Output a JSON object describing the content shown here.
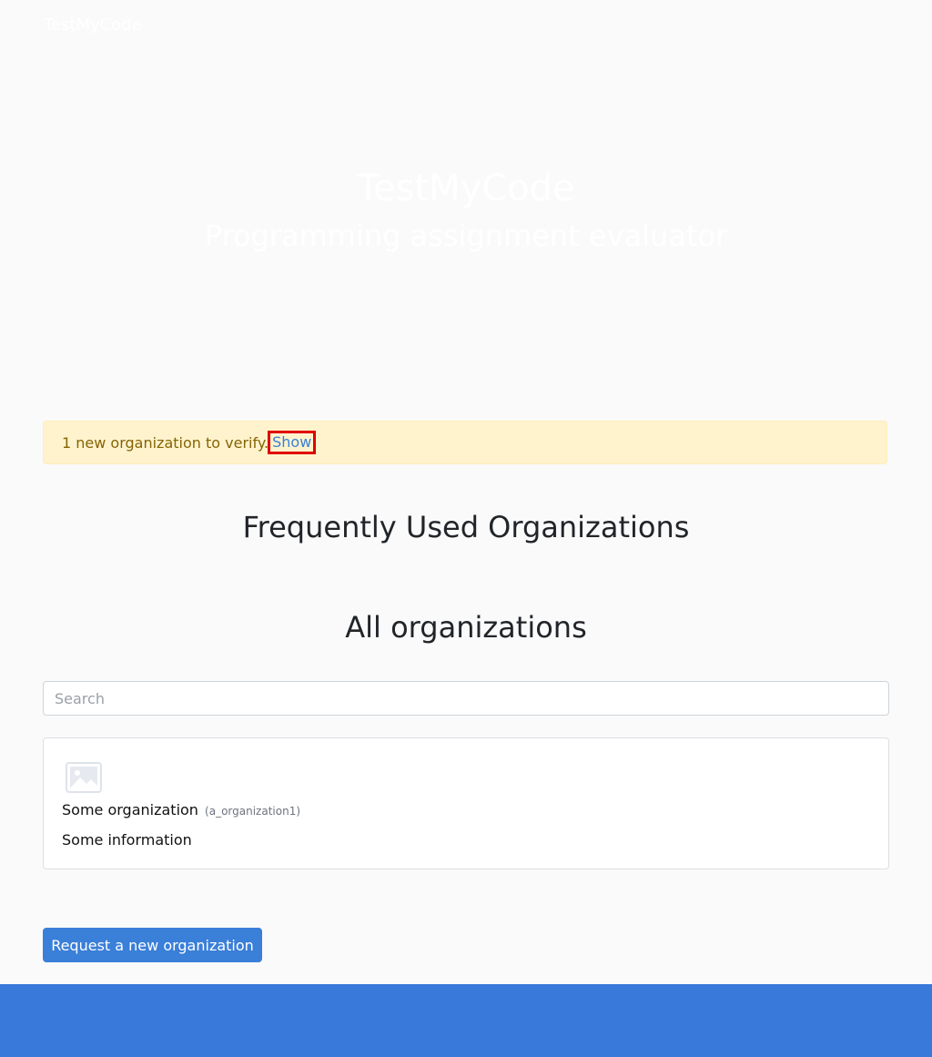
{
  "navbar": {
    "brand": "TestMyCode"
  },
  "hero": {
    "title": "TestMyCode",
    "subtitle": "Programming assignment evaluator"
  },
  "alert": {
    "message": "1 new organization to verify.",
    "link_label": "Show"
  },
  "frequent": {
    "title": "Frequently Used Organizations"
  },
  "all": {
    "title": "All organizations",
    "search_placeholder": "Search",
    "search_value": ""
  },
  "organizations": [
    {
      "logo_icon": "image-placeholder-icon",
      "name": "Some organization",
      "slug": "(a_organization1)",
      "information": "Some information"
    }
  ],
  "actions": {
    "request_label": "Request a new organization"
  },
  "colors": {
    "primary": "#3a7fd8",
    "footer": "#3879d9",
    "alert_bg": "#fff3cd",
    "alert_text": "#856404",
    "highlight": "#e00000"
  }
}
